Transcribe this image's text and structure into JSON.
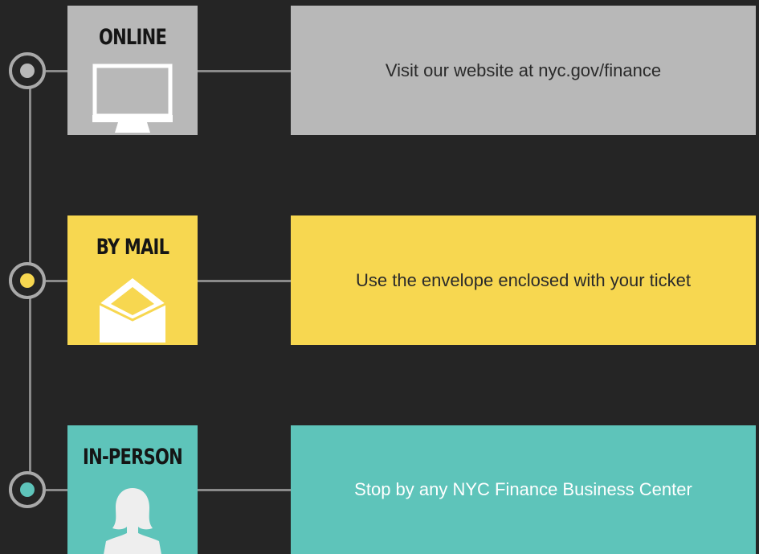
{
  "channels": [
    {
      "title": "ONLINE",
      "description": "Visit our website at nyc.gov/finance",
      "icon": "monitor-icon",
      "color": "#b8b8b8",
      "dot_color": "#b8b8b8"
    },
    {
      "title": "BY MAIL",
      "description": "Use the envelope enclosed with your ticket",
      "icon": "envelope-icon",
      "color": "#f7d750",
      "dot_color": "#f7d750"
    },
    {
      "title": "IN-PERSON",
      "description": "Stop by any NYC Finance Business Center",
      "icon": "person-icon",
      "color": "#5ec4ba",
      "dot_color": "#5ec4ba"
    }
  ],
  "background_color": "#252525",
  "line_color": "#8a8a8a"
}
